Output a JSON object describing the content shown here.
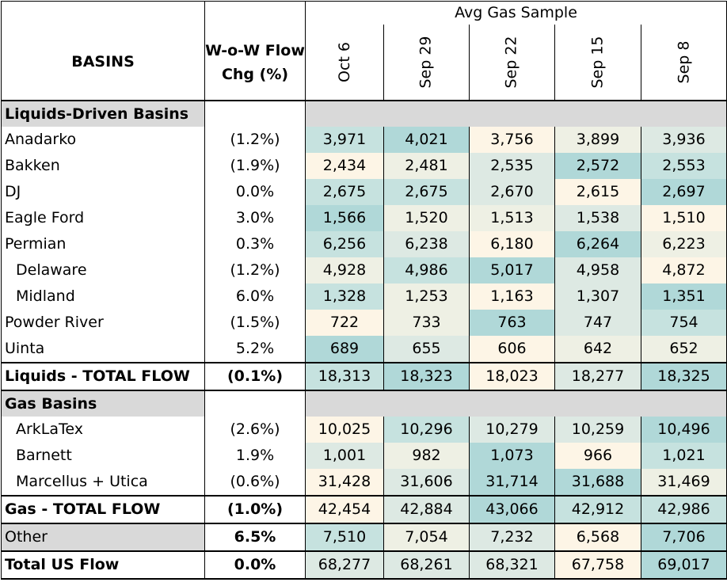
{
  "header": {
    "group_title": "Avg Gas Sample",
    "col_basins": "BASINS",
    "col_wow": "W-o-W Flow Chg (%)",
    "dates": [
      "Oct 6",
      "Sep 29",
      "Sep 22",
      "Sep 15",
      "Sep 8"
    ]
  },
  "heat_colors": {
    "cream": "#fdf5e6",
    "light": "#eef0e4",
    "pale": "#dde9e3",
    "mid": "#c6e2df",
    "teal": "#b0d8d8"
  },
  "sections": {
    "liquids": "Liquids-Driven Basins",
    "gas": "Gas Basins"
  },
  "rows": [
    {
      "name": "Anadarko",
      "wow": "(1.2%)",
      "vals": [
        "3,971",
        "4,021",
        "3,756",
        "3,899",
        "3,936"
      ],
      "heat": [
        "mid",
        "teal",
        "cream",
        "light",
        "pale"
      ]
    },
    {
      "name": "Bakken",
      "wow": "(1.9%)",
      "vals": [
        "2,434",
        "2,481",
        "2,535",
        "2,572",
        "2,553"
      ],
      "heat": [
        "cream",
        "light",
        "pale",
        "teal",
        "mid"
      ]
    },
    {
      "name": "DJ",
      "wow": "0.0%",
      "vals": [
        "2,675",
        "2,675",
        "2,670",
        "2,615",
        "2,697"
      ],
      "heat": [
        "mid",
        "mid",
        "pale",
        "cream",
        "teal"
      ]
    },
    {
      "name": "Eagle Ford",
      "wow": "3.0%",
      "vals": [
        "1,566",
        "1,520",
        "1,513",
        "1,538",
        "1,510"
      ],
      "heat": [
        "teal",
        "light",
        "light",
        "pale",
        "cream"
      ]
    },
    {
      "name": "Permian",
      "wow": "0.3%",
      "vals": [
        "6,256",
        "6,238",
        "6,180",
        "6,264",
        "6,223"
      ],
      "heat": [
        "mid",
        "pale",
        "cream",
        "teal",
        "light"
      ]
    },
    {
      "name": "Delaware",
      "wow": "(1.2%)",
      "vals": [
        "4,928",
        "4,986",
        "5,017",
        "4,958",
        "4,872"
      ],
      "heat": [
        "light",
        "mid",
        "teal",
        "pale",
        "cream"
      ]
    },
    {
      "name": "Midland",
      "wow": "6.0%",
      "vals": [
        "1,328",
        "1,253",
        "1,163",
        "1,307",
        "1,351"
      ],
      "heat": [
        "mid",
        "light",
        "cream",
        "pale",
        "teal"
      ]
    },
    {
      "name": "Powder River",
      "wow": "(1.5%)",
      "vals": [
        "722",
        "733",
        "763",
        "747",
        "754"
      ],
      "heat": [
        "cream",
        "light",
        "teal",
        "pale",
        "mid"
      ]
    },
    {
      "name": "Uinta",
      "wow": "5.2%",
      "vals": [
        "689",
        "655",
        "606",
        "642",
        "652"
      ],
      "heat": [
        "teal",
        "pale",
        "cream",
        "light",
        "light"
      ]
    }
  ],
  "liquids_total": {
    "name": "Liquids - TOTAL FLOW",
    "wow": "(0.1%)",
    "vals": [
      "18,313",
      "18,323",
      "18,023",
      "18,277",
      "18,325"
    ],
    "heat": [
      "mid",
      "teal",
      "cream",
      "pale",
      "teal"
    ]
  },
  "gas_rows": [
    {
      "name": "ArkLaTex",
      "wow": "(2.6%)",
      "vals": [
        "10,025",
        "10,296",
        "10,279",
        "10,259",
        "10,496"
      ],
      "heat": [
        "cream",
        "mid",
        "pale",
        "pale",
        "teal"
      ]
    },
    {
      "name": "Barnett",
      "wow": "1.9%",
      "vals": [
        "1,001",
        "982",
        "1,073",
        "966",
        "1,021"
      ],
      "heat": [
        "pale",
        "light",
        "teal",
        "cream",
        "mid"
      ]
    },
    {
      "name": "Marcellus + Utica",
      "wow": "(0.6%)",
      "vals": [
        "31,428",
        "31,606",
        "31,714",
        "31,688",
        "31,469"
      ],
      "heat": [
        "cream",
        "pale",
        "teal",
        "teal",
        "light"
      ]
    }
  ],
  "gas_total": {
    "name": "Gas - TOTAL FLOW",
    "wow": "(1.0%)",
    "vals": [
      "42,454",
      "42,884",
      "43,066",
      "42,912",
      "42,986"
    ],
    "heat": [
      "cream",
      "pale",
      "teal",
      "mid",
      "mid"
    ]
  },
  "other": {
    "name": "Other",
    "wow": "6.5%",
    "vals": [
      "7,510",
      "7,054",
      "7,232",
      "6,568",
      "7,706"
    ],
    "heat": [
      "mid",
      "light",
      "pale",
      "cream",
      "teal"
    ]
  },
  "total_us": {
    "name": "Total US Flow",
    "wow": "0.0%",
    "vals": [
      "68,277",
      "68,261",
      "68,321",
      "67,758",
      "69,017"
    ],
    "heat": [
      "pale",
      "pale",
      "pale",
      "cream",
      "teal"
    ]
  }
}
